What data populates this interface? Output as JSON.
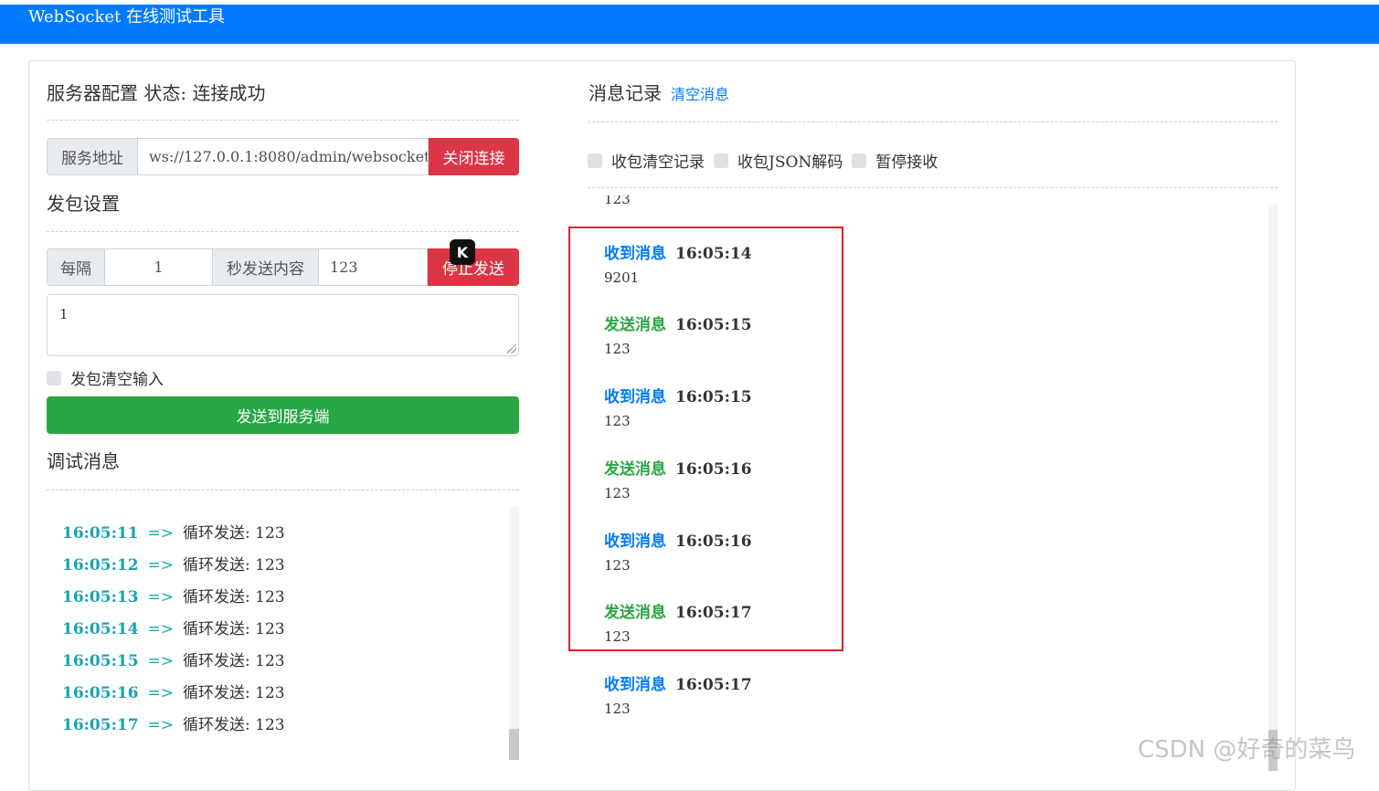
{
  "app": {
    "title": "WebSocket 在线测试工具"
  },
  "server": {
    "heading": "服务器配置 状态: 连接成功",
    "address_label": "服务地址",
    "address_value": "ws://127.0.0.1:8080/admin/websocket",
    "close_button": "关闭连接"
  },
  "send_settings": {
    "heading": "发包设置",
    "every_label": "每隔",
    "interval_value": "1",
    "content_label": "秒发送内容",
    "content_value": "123",
    "stop_button": "停止发送",
    "textarea_value": "1",
    "clear_input_label": "发包清空输入",
    "send_button": "发送到服务端",
    "overlay_badge": "K"
  },
  "debug": {
    "heading": "调试消息",
    "rows": [
      {
        "time": "16:05:11",
        "arrow": "=>",
        "text": "循环发送: 123"
      },
      {
        "time": "16:05:12",
        "arrow": "=>",
        "text": "循环发送: 123"
      },
      {
        "time": "16:05:13",
        "arrow": "=>",
        "text": "循环发送: 123"
      },
      {
        "time": "16:05:14",
        "arrow": "=>",
        "text": "循环发送: 123"
      },
      {
        "time": "16:05:15",
        "arrow": "=>",
        "text": "循环发送: 123"
      },
      {
        "time": "16:05:16",
        "arrow": "=>",
        "text": "循环发送: 123"
      },
      {
        "time": "16:05:17",
        "arrow": "=>",
        "text": "循环发送: 123"
      }
    ]
  },
  "messages": {
    "heading": "消息记录",
    "clear_link": "清空消息",
    "options": [
      "收包清空记录",
      "收包JSON解码",
      "暂停接收"
    ],
    "partial_top": "123",
    "items": [
      {
        "kind": "收到消息",
        "type": "recv",
        "time": "16:05:14",
        "body": "9201"
      },
      {
        "kind": "发送消息",
        "type": "sent",
        "time": "16:05:15",
        "body": "123"
      },
      {
        "kind": "收到消息",
        "type": "recv",
        "time": "16:05:15",
        "body": "123"
      },
      {
        "kind": "发送消息",
        "type": "sent",
        "time": "16:05:16",
        "body": "123"
      },
      {
        "kind": "收到消息",
        "type": "recv",
        "time": "16:05:16",
        "body": "123"
      },
      {
        "kind": "发送消息",
        "type": "sent",
        "time": "16:05:17",
        "body": "123"
      },
      {
        "kind": "收到消息",
        "type": "recv",
        "time": "16:05:17",
        "body": "123"
      }
    ]
  },
  "watermark": "CSDN @好奇的菜鸟",
  "colors": {
    "primary": "#007bff",
    "danger": "#dc3545",
    "success": "#28a745",
    "info": "#17a2b8",
    "highlight_border": "#e0202a"
  }
}
